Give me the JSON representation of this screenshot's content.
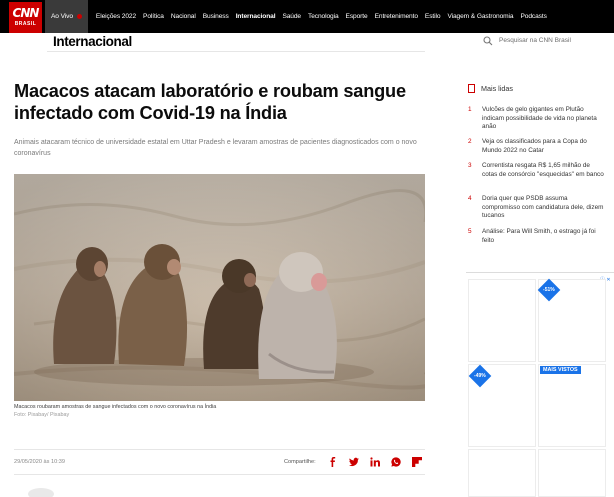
{
  "brand": {
    "logo_text": "CNN",
    "logo_sub": "BRASIL"
  },
  "nav": {
    "items": [
      {
        "label": "Ao Vivo"
      },
      {
        "label": "Eleições 2022"
      },
      {
        "label": "Política"
      },
      {
        "label": "Nacional"
      },
      {
        "label": "Business"
      },
      {
        "label": "Internacional"
      },
      {
        "label": "Saúde"
      },
      {
        "label": "Tecnologia"
      },
      {
        "label": "Esporte"
      },
      {
        "label": "Entretenimento"
      },
      {
        "label": "Estilo"
      },
      {
        "label": "Viagem & Gastronomia"
      },
      {
        "label": "Podcasts"
      }
    ],
    "active": "Internacional"
  },
  "section": {
    "title": "Internacional"
  },
  "search": {
    "placeholder": "Pesquisar na CNN Brasil",
    "icon": "search-icon"
  },
  "article": {
    "headline": "Macacos atacam laboratório e roubam sangue infectado com Covid-19 na Índia",
    "subhead": "Animais atacaram técnico de universidade estatal em Uttar Pradesh e levaram amostras de pacientes diagnosticados com o novo coronavírus",
    "image_caption": "Macacos roubaram amostras de sangue infectados com o novo coronavírus na Índia",
    "image_credit": "Foto: Pixabay/ Pixabay",
    "date": "29/05/2020 às 10:39",
    "share_label": "Compartilhe:",
    "share_icons": [
      "facebook-icon",
      "twitter-icon",
      "linkedin-icon",
      "whatsapp-icon",
      "flipboard-icon"
    ]
  },
  "sidebar": {
    "mais_lidas_title": "Mais lidas",
    "items": [
      {
        "num": "1",
        "text": "Vulcões de gelo gigantes em Plutão indicam possibilidade de vida no planeta anão"
      },
      {
        "num": "2",
        "text": "Veja os classificados para a Copa do Mundo 2022 no Catar"
      },
      {
        "num": "3",
        "text": "Correntista resgata R$ 1,65 milhão de cotas de consórcio \"esquecidas\" em banco"
      },
      {
        "num": "4",
        "text": "Doria quer que PSDB assuma compromisso com candidatura dele, dizem tucanos"
      },
      {
        "num": "5",
        "text": "Análise: Para Will Smith, o estrago já foi feito"
      }
    ],
    "ads": {
      "badge1": "-51%",
      "badge2": "-49%",
      "tag": "MAIS VISTOS",
      "info": "ⓘ ✕"
    }
  },
  "colors": {
    "brand_red": "#cc0000",
    "nav_bg": "#000000",
    "ad_blue": "#1a73e8"
  }
}
